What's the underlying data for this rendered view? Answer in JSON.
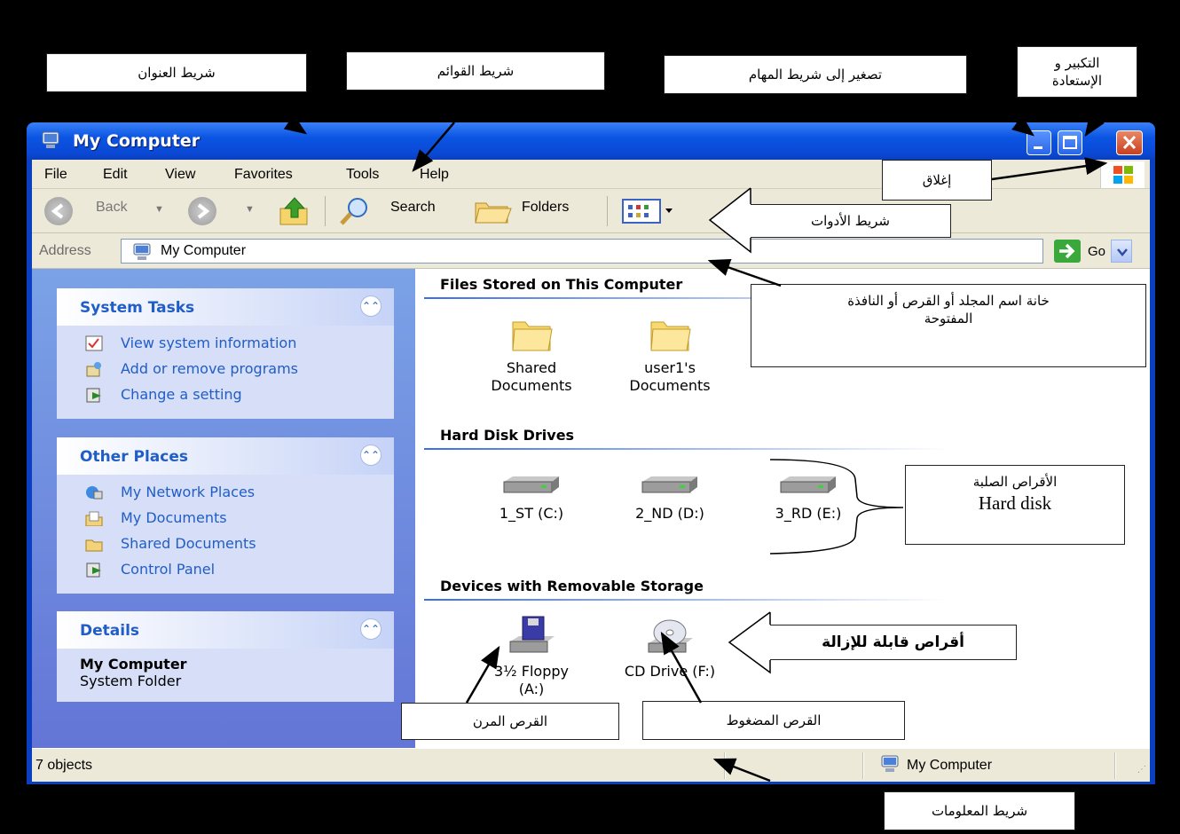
{
  "window": {
    "title": "My Computer",
    "menu": [
      "File",
      "Edit",
      "View",
      "Favorites",
      "Tools",
      "Help"
    ],
    "toolbar": {
      "back": "Back",
      "search": "Search",
      "folders": "Folders"
    },
    "address": {
      "label": "Address",
      "value": "My Computer",
      "go": "Go"
    },
    "panels": {
      "system_tasks": {
        "title": "System Tasks",
        "items": [
          "View system information",
          "Add or remove programs",
          "Change a setting"
        ]
      },
      "other_places": {
        "title": "Other Places",
        "items": [
          "My Network Places",
          "My Documents",
          "Shared Documents",
          "Control Panel"
        ]
      },
      "details": {
        "title": "Details",
        "name": "My Computer",
        "sub": "System Folder"
      }
    },
    "content": {
      "files": {
        "title": "Files Stored on This Computer",
        "items": [
          {
            "line1": "Shared",
            "line2": "Documents"
          },
          {
            "line1": "user1's",
            "line2": "Documents"
          }
        ]
      },
      "hdd": {
        "title": "Hard Disk Drives",
        "items": [
          "1_ST (C:)",
          "2_ND (D:)",
          "3_RD (E:)"
        ]
      },
      "removable": {
        "title": "Devices with Removable Storage",
        "items": [
          {
            "line1": "3½ Floppy",
            "line2": "(A:)"
          },
          {
            "line1": "CD Drive (F:)",
            "line2": ""
          }
        ]
      }
    },
    "status": {
      "left": "7 objects",
      "right": "My Computer"
    }
  },
  "callouts": {
    "title_bar": "شريط العنوان",
    "menu_bar": "شريط القوائم",
    "minimize": "تصغير إلى شريط المهام",
    "maximize_line1": "التكبير و",
    "maximize_line2": "الإستعادة",
    "close": "إغلاق",
    "toolbar": "شريط الأدوات",
    "address_line1": "خانة اسم المجلد أو القرص أو النافذة",
    "address_line2": "المفتوحة",
    "hdd_line1": "الأقراص الصلبة",
    "hdd_line2": "Hard disk",
    "removable": "أقراص قابلة للإزالة",
    "floppy": "القرص المرن",
    "cd": "القرص المضغوط",
    "statusbar": "شريط المعلومات"
  },
  "colors": {
    "title_gradient": "#0b55e3",
    "link": "#215dc6",
    "pane": "#7ba2e7"
  }
}
